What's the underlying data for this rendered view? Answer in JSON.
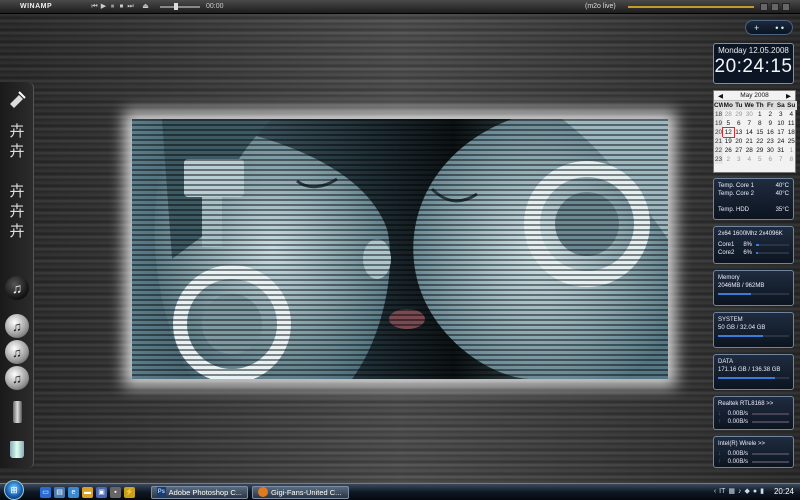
{
  "winamp": {
    "logo": "WINAMP",
    "controls": [
      "⏮",
      "▶",
      "⏸",
      "⏹",
      "⏭",
      "⏏"
    ],
    "time": "00:00",
    "track": "(m2o live)"
  },
  "top_pill": {
    "add": "+",
    "dots": "• •"
  },
  "dock": {
    "items": [
      {
        "name": "audio-cable-icon",
        "glyph": "⚡"
      },
      {
        "name": "audio-glyph-icon-1",
        "glyph": "卉"
      },
      {
        "name": "audio-glyph-icon-2",
        "glyph": "卉"
      },
      {
        "name": "audio-glyph-icon-3",
        "glyph": "卉"
      },
      {
        "name": "audio-glyph-icon-4",
        "glyph": "卉"
      },
      {
        "name": "audio-glyph-icon-5",
        "glyph": "卉"
      },
      {
        "name": "itunes-dark-icon",
        "glyph": "♫"
      },
      {
        "name": "itunes-icon-1",
        "glyph": "♫"
      },
      {
        "name": "itunes-icon-2",
        "glyph": "♫"
      },
      {
        "name": "itunes-icon-3",
        "glyph": "♫"
      }
    ]
  },
  "clock": {
    "date": "Monday 12.05.2008",
    "time": "20:24:15"
  },
  "calendar": {
    "month": "May 2008",
    "headers": [
      "CW",
      "Mo",
      "Tu",
      "We",
      "Th",
      "Fr",
      "Sa",
      "Su"
    ],
    "rows": [
      [
        "18",
        "28",
        "29",
        "30",
        "1",
        "2",
        "3",
        "4"
      ],
      [
        "19",
        "5",
        "6",
        "7",
        "8",
        "9",
        "10",
        "11"
      ],
      [
        "20",
        "12",
        "13",
        "14",
        "15",
        "16",
        "17",
        "18"
      ],
      [
        "21",
        "19",
        "20",
        "21",
        "22",
        "23",
        "24",
        "25"
      ],
      [
        "22",
        "26",
        "27",
        "28",
        "29",
        "30",
        "31",
        "1"
      ],
      [
        "23",
        "2",
        "3",
        "4",
        "5",
        "6",
        "7",
        "8"
      ]
    ],
    "today": "12"
  },
  "temps": {
    "core1_label": "Temp. Core 1",
    "core1": "40°C",
    "core2_label": "Temp. Core 2",
    "core2": "40°C",
    "hdd_label": "Temp. HDD",
    "hdd": "35°C"
  },
  "cpu": {
    "title": "2x64 1600Mhz 2x4096K",
    "core1_label": "Core1",
    "core1": "8%",
    "core1_pct": 8,
    "core2_label": "Core2",
    "core2": "6%",
    "core2_pct": 6
  },
  "memory": {
    "title": "Memory",
    "value": "2046MB / 962MB",
    "pct": 47
  },
  "system_drive": {
    "title": "SYSTEM",
    "value": "50 GB / 32.04 GB",
    "pct": 64
  },
  "data_drive": {
    "title": "DATA",
    "value": "171.16 GB / 136.38 GB",
    "pct": 80
  },
  "net1": {
    "title": "Realtek RTL8168 >>",
    "down": "0.00B/s",
    "up": "0.00B/s"
  },
  "net2": {
    "title": "Intel(R) Wirele >>",
    "down": "0.00B/s",
    "up": "0.00B/s"
  },
  "taskbar": {
    "task1": "Adobe Photoshop C...",
    "task1_icon": "Ps",
    "task2": "Gigi-Fans-United C...",
    "time": "20:24",
    "lang": "IT"
  },
  "colors": {
    "accent": "#3b7bd8",
    "seek": "#c49a2a"
  }
}
